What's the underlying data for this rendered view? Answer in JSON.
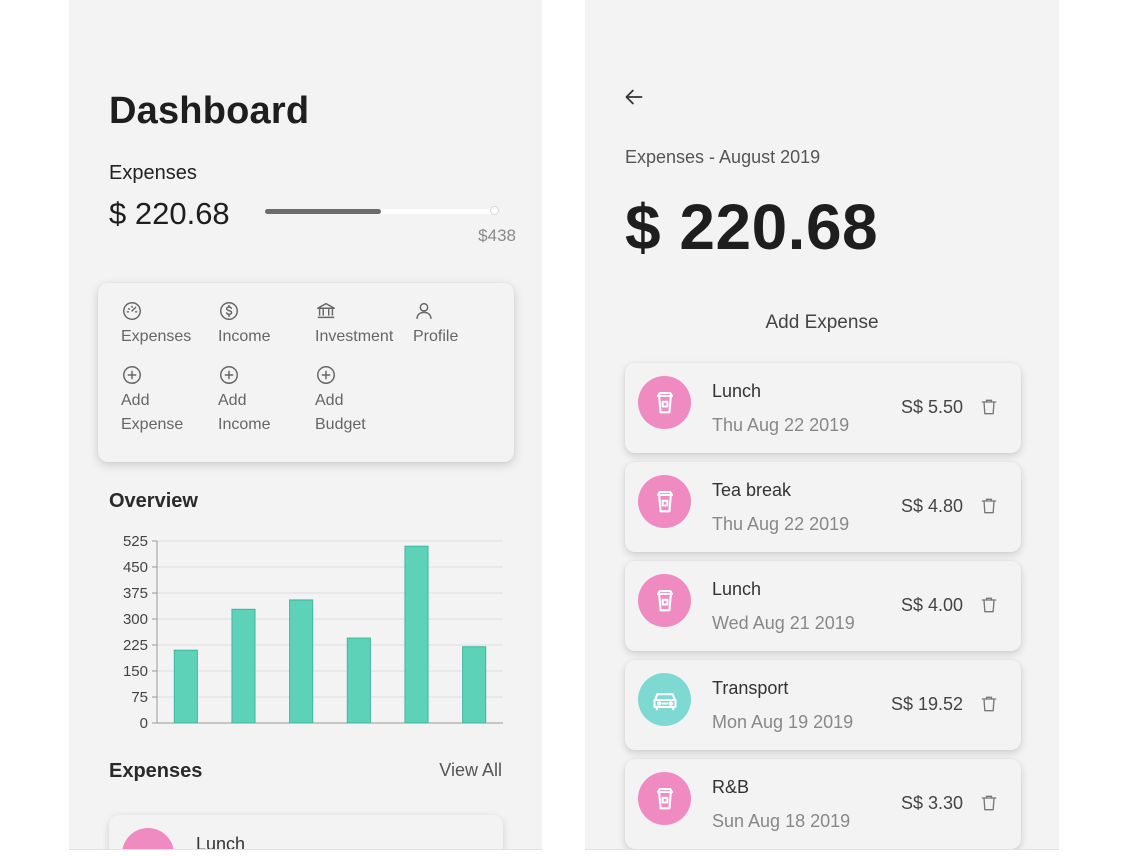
{
  "dashboard": {
    "title": "Dashboard",
    "expenses_label": "Expenses",
    "expenses_amount": "$ 220.68",
    "budget_label": "$438",
    "progress_fraction": 0.504,
    "menu": [
      {
        "label": "Expenses",
        "icon": "speedometer-icon"
      },
      {
        "label": "Income",
        "icon": "dollar-circle-icon"
      },
      {
        "label": "Investment",
        "icon": "bank-icon"
      },
      {
        "label": "Profile",
        "icon": "person-icon"
      },
      {
        "label": "Add\nExpense",
        "icon": "plus-circle-icon"
      },
      {
        "label": "Add\nIncome",
        "icon": "plus-circle-icon"
      },
      {
        "label": "Add\nBudget",
        "icon": "plus-circle-icon"
      }
    ],
    "overview_title": "Overview",
    "expenses_section_title": "Expenses",
    "view_all_label": "View All",
    "preview_item_title": "Lunch"
  },
  "chart_data": {
    "type": "bar",
    "title": "",
    "xlabel": "",
    "ylabel": "",
    "categories": [
      "",
      "",
      "",
      "",
      "",
      ""
    ],
    "values": [
      210,
      328,
      355,
      245,
      510,
      220
    ],
    "ylim": [
      0,
      525
    ],
    "yticks": [
      0,
      75,
      150,
      225,
      300,
      375,
      450,
      525
    ],
    "grid": true,
    "bar_color": "#5dd2b8",
    "bar_edge_color": "#3cb89c"
  },
  "detail": {
    "month_label": "Expenses - August 2019",
    "total": "$ 220.68",
    "add_expense_label": "Add Expense",
    "items": [
      {
        "title": "Lunch",
        "date": "Thu Aug 22 2019",
        "amount": "S$ 5.50",
        "icon": "cup-icon",
        "color": "#ef8bc1"
      },
      {
        "title": "Tea break",
        "date": "Thu Aug 22 2019",
        "amount": "S$ 4.80",
        "icon": "cup-icon",
        "color": "#ef8bc1"
      },
      {
        "title": "Lunch",
        "date": "Wed Aug 21 2019",
        "amount": "S$ 4.00",
        "icon": "cup-icon",
        "color": "#ef8bc1"
      },
      {
        "title": "Transport",
        "date": "Mon Aug 19 2019",
        "amount": "S$ 19.52",
        "icon": "car-icon",
        "color": "#7fd9d3"
      },
      {
        "title": "R&B",
        "date": "Sun Aug 18 2019",
        "amount": "S$ 3.30",
        "icon": "cup-icon",
        "color": "#ef8bc1"
      }
    ]
  },
  "colors": {
    "screen_bg": "#f3f3f3",
    "accent_bar": "#5dd2b8",
    "food_category": "#ef8bc1",
    "transport_category": "#7fd9d3"
  }
}
